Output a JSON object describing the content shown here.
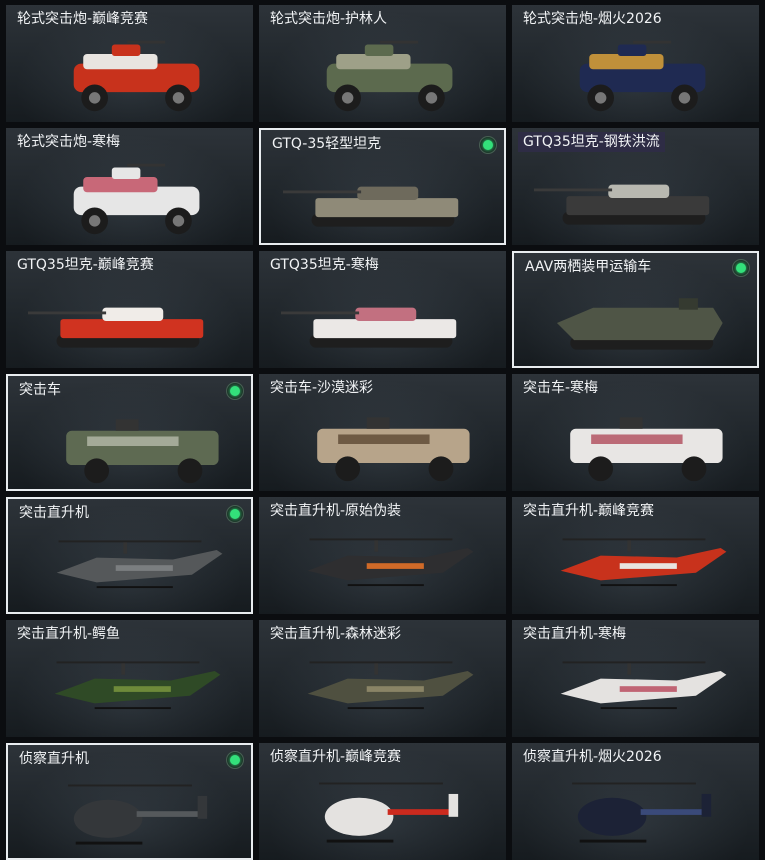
{
  "grid": {
    "items": [
      {
        "label": "轮式突击炮-巅峰竞赛",
        "equipped": false,
        "tag": false,
        "kind": "apc",
        "colors": [
          "#c8321c",
          "#e8e4e0"
        ]
      },
      {
        "label": "轮式突击炮-护林人",
        "equipped": false,
        "tag": false,
        "kind": "apc",
        "colors": [
          "#5c6a4e",
          "#9ea088"
        ]
      },
      {
        "label": "轮式突击炮-烟火2026",
        "equipped": false,
        "tag": false,
        "kind": "apc",
        "colors": [
          "#1f2a52",
          "#c0903a"
        ]
      },
      {
        "label": "轮式突击炮-寒梅",
        "equipped": false,
        "tag": false,
        "kind": "apc",
        "colors": [
          "#e6e6e6",
          "#c86878"
        ]
      },
      {
        "label": "GTQ-35轻型坦克",
        "equipped": true,
        "tag": false,
        "kind": "tank",
        "colors": [
          "#8f8a78",
          "#6e6a5c"
        ]
      },
      {
        "label": "GTQ35坦克-钢铁洪流",
        "equipped": false,
        "tag": true,
        "kind": "tank",
        "colors": [
          "#3a3a3a",
          "#b8b8b0"
        ]
      },
      {
        "label": "GTQ35坦克-巅峰竞赛",
        "equipped": false,
        "tag": false,
        "kind": "tank",
        "colors": [
          "#d03320",
          "#f0ece8"
        ]
      },
      {
        "label": "GTQ35坦克-寒梅",
        "equipped": false,
        "tag": false,
        "kind": "tank",
        "colors": [
          "#ebe8e6",
          "#c27080"
        ]
      },
      {
        "label": "AAV两栖装甲运输车",
        "equipped": true,
        "tag": false,
        "kind": "aav",
        "colors": [
          "#4f5546",
          "#353a30"
        ]
      },
      {
        "label": "突击车",
        "equipped": true,
        "tag": false,
        "kind": "truck",
        "colors": [
          "#5e6a52",
          "#a4aa98"
        ]
      },
      {
        "label": "突击车-沙漠迷彩",
        "equipped": false,
        "tag": false,
        "kind": "truck",
        "colors": [
          "#b7a48a",
          "#6e5a44"
        ]
      },
      {
        "label": "突击车-寒梅",
        "equipped": false,
        "tag": false,
        "kind": "truck",
        "colors": [
          "#e8e6e4",
          "#bb6a76"
        ]
      },
      {
        "label": "突击直升机",
        "equipped": true,
        "tag": false,
        "kind": "heli",
        "colors": [
          "#55585a",
          "#7b7e80"
        ]
      },
      {
        "label": "突击直升机-原始伪装",
        "equipped": false,
        "tag": false,
        "kind": "heli",
        "colors": [
          "#2e2e30",
          "#d06a28"
        ]
      },
      {
        "label": "突击直升机-巅峰竞赛",
        "equipped": false,
        "tag": false,
        "kind": "heli",
        "colors": [
          "#c8321c",
          "#e8e4e0"
        ]
      },
      {
        "label": "突击直升机-鳄鱼",
        "equipped": false,
        "tag": false,
        "kind": "heli",
        "colors": [
          "#2f4a26",
          "#6e8a3a"
        ]
      },
      {
        "label": "突击直升机-森林迷彩",
        "equipped": false,
        "tag": false,
        "kind": "heli",
        "colors": [
          "#4f5040",
          "#8a8466"
        ]
      },
      {
        "label": "突击直升机-寒梅",
        "equipped": false,
        "tag": false,
        "kind": "heli",
        "colors": [
          "#e4e2e0",
          "#c06474"
        ]
      },
      {
        "label": "侦察直升机",
        "equipped": true,
        "tag": false,
        "kind": "scout",
        "colors": [
          "#34373a",
          "#55595c"
        ]
      },
      {
        "label": "侦察直升机-巅峰竞赛",
        "equipped": false,
        "tag": false,
        "kind": "scout",
        "colors": [
          "#e4e2e0",
          "#cc2a1e"
        ]
      },
      {
        "label": "侦察直升机-烟火2026",
        "equipped": false,
        "tag": false,
        "kind": "scout",
        "colors": [
          "#1c2236",
          "#3a4a7a"
        ]
      }
    ]
  }
}
